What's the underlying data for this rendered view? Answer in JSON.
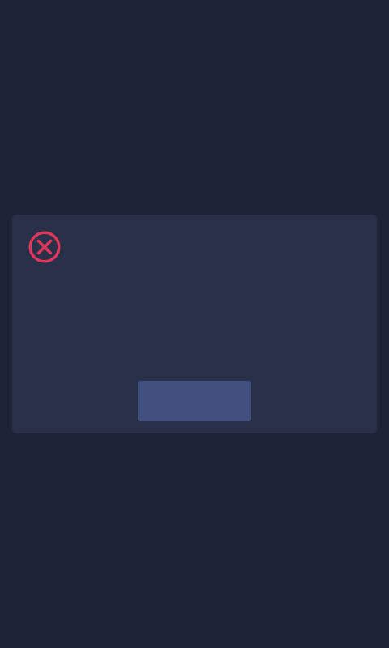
{
  "colors": {
    "background": "#1f2337",
    "dialog_background": "#293049",
    "error_accent": "#e0365a",
    "button_background": "#43507f"
  },
  "dialog": {
    "icon": "error-circle-x-icon",
    "message": "",
    "button_label": ""
  }
}
